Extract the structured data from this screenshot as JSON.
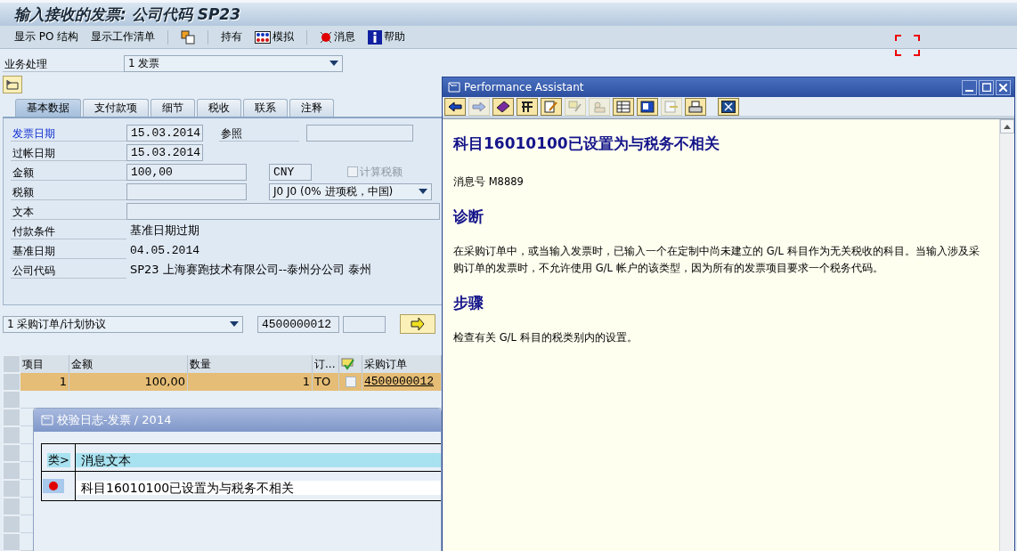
{
  "window": {
    "title": "输入接收的发票: 公司代码 SP23"
  },
  "toolbar": [
    {
      "kind": "text",
      "label": "显示 PO 结构"
    },
    {
      "kind": "text",
      "label": "显示工作清单"
    },
    {
      "kind": "separator"
    },
    {
      "kind": "copy"
    },
    {
      "kind": "separator"
    },
    {
      "kind": "text",
      "label": "持有"
    },
    {
      "kind": "simulate",
      "label": "模拟"
    },
    {
      "kind": "separator"
    },
    {
      "kind": "message",
      "label": "消息"
    },
    {
      "kind": "help",
      "label": "帮助"
    }
  ],
  "transaction": {
    "label": "业务处理",
    "value": "1 发票"
  },
  "tabs": [
    {
      "label": "基本数据",
      "selected": true
    },
    {
      "label": "支付款项",
      "selected": false
    },
    {
      "label": "细节",
      "selected": false
    },
    {
      "label": "税收",
      "selected": false
    },
    {
      "label": "联系",
      "selected": false
    },
    {
      "label": "注释",
      "selected": false
    }
  ],
  "form": [
    {
      "label": "发票日期",
      "highlighted": true,
      "kind": "date",
      "value": "15.03.2014",
      "extra": {
        "kind": "reference",
        "label": "参照"
      }
    },
    {
      "label": "过帐日期",
      "highlighted": false,
      "kind": "date",
      "value": "15.03.2014"
    },
    {
      "label": "金额",
      "highlighted": false,
      "kind": "amount",
      "value": "100,00",
      "extra": {
        "kind": "currency",
        "value": "CNY",
        "checkbox_label": "计算税额",
        "checked": false
      }
    },
    {
      "label": "税额",
      "highlighted": false,
      "kind": "amount",
      "extra": {
        "kind": "dropdown",
        "value": "J0 J0 (0% 进项税，中国)"
      }
    },
    {
      "label": "文本",
      "highlighted": false,
      "kind": "wide"
    },
    {
      "label": "付款条件",
      "highlighted": false,
      "kind": "display",
      "value": "基准日期过期"
    },
    {
      "label": "基准日期",
      "highlighted": false,
      "kind": "display-mono",
      "value": "04.05.2014"
    },
    {
      "label": "公司代码",
      "highlighted": false,
      "kind": "display",
      "value": "SP23 上海赛跑技术有限公司--泰州分公司 泰州"
    }
  ],
  "reference": {
    "document_type": "1 采购订单/计划协议",
    "po_number": "4500000012"
  },
  "table": {
    "columns": [
      {
        "kind": "text",
        "label": "项目"
      },
      {
        "kind": "text",
        "label": "金额"
      },
      {
        "kind": "text",
        "label": "数量"
      },
      {
        "kind": "text",
        "label": "订..."
      },
      {
        "kind": "icon"
      },
      {
        "kind": "text",
        "label": "采购订单"
      }
    ],
    "rows": [
      {
        "selected": true,
        "item": "1",
        "amount": "100,00",
        "quantity": "1",
        "unit": "TO",
        "checked": false,
        "purchase_order": "4500000012"
      }
    ]
  },
  "log": {
    "title": "校验日志-发票  / 2014",
    "columns": [
      "类>",
      "消息文本"
    ],
    "rows": [
      {
        "kind": "error",
        "text": "科目16010100已设置为与税务不相关"
      }
    ]
  },
  "assistant": {
    "title": "Performance Assistant",
    "tools": [
      {
        "kind": "back",
        "disabled": false
      },
      {
        "kind": "forward",
        "disabled": true
      },
      {
        "kind": "book",
        "disabled": false
      },
      {
        "kind": "tools",
        "disabled": false
      },
      {
        "kind": "edit",
        "disabled": false
      },
      {
        "kind": "note",
        "disabled": true
      },
      {
        "kind": "person",
        "disabled": true
      },
      {
        "kind": "table",
        "disabled": false
      },
      {
        "kind": "layout",
        "disabled": false
      },
      {
        "kind": "export",
        "disabled": true
      },
      {
        "kind": "print",
        "disabled": false
      },
      {
        "kind": "close",
        "disabled": false
      }
    ],
    "heading": "科目16010100已设置为与税务不相关",
    "message_number": "消息号  M8889",
    "sections": [
      {
        "heading": "诊断",
        "text": "在采购订单中，或当输入发票时，已输入一个在定制中尚未建立的  G/L 科目作为无关税收的科目。当输入涉及采购订单的发票时，不允许使用  G/L 帐户的该类型，因为所有的发票项目要求一个税务代码。"
      },
      {
        "heading": "步骤",
        "text": "检查有关  G/L 科目的税类别内的设置。"
      }
    ]
  }
}
